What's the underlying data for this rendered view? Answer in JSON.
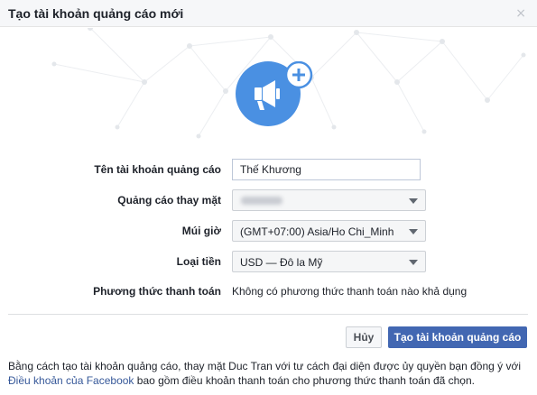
{
  "dialog": {
    "title": "Tạo tài khoản quảng cáo mới",
    "close_glyph": "×"
  },
  "form": {
    "account_name_label": "Tên tài khoản quảng cáo",
    "account_name_value": "Thế Khương",
    "ads_for_label": "Quảng cáo thay mặt",
    "timezone_label": "Múi giờ",
    "timezone_value": "(GMT+07:00) Asia/Ho Chi_Minh",
    "currency_label": "Loại tiền",
    "currency_value": "USD — Đô la Mỹ",
    "payment_label": "Phương thức thanh toán",
    "payment_value": "Không có phương thức thanh toán nào khả dụng"
  },
  "buttons": {
    "cancel": "Hủy",
    "create": "Tạo tài khoản quảng cáo"
  },
  "footer": {
    "text_before": "Bằng cách tạo tài khoản quảng cáo, thay mặt Duc Tran với tư cách đại diện được ủy quyền bạn đồng ý với ",
    "link": "Điều khoản của Facebook",
    "text_after": " bao gồm điều khoản thanh toán cho phương thức thanh toán đã chọn."
  },
  "icons": {
    "hero": "megaphone-icon",
    "plus": "plus-icon",
    "close": "close-icon",
    "caret": "chevron-down-icon"
  },
  "colors": {
    "hero_blue": "#4a90e2",
    "primary_button": "#4267b2",
    "link": "#365899"
  }
}
